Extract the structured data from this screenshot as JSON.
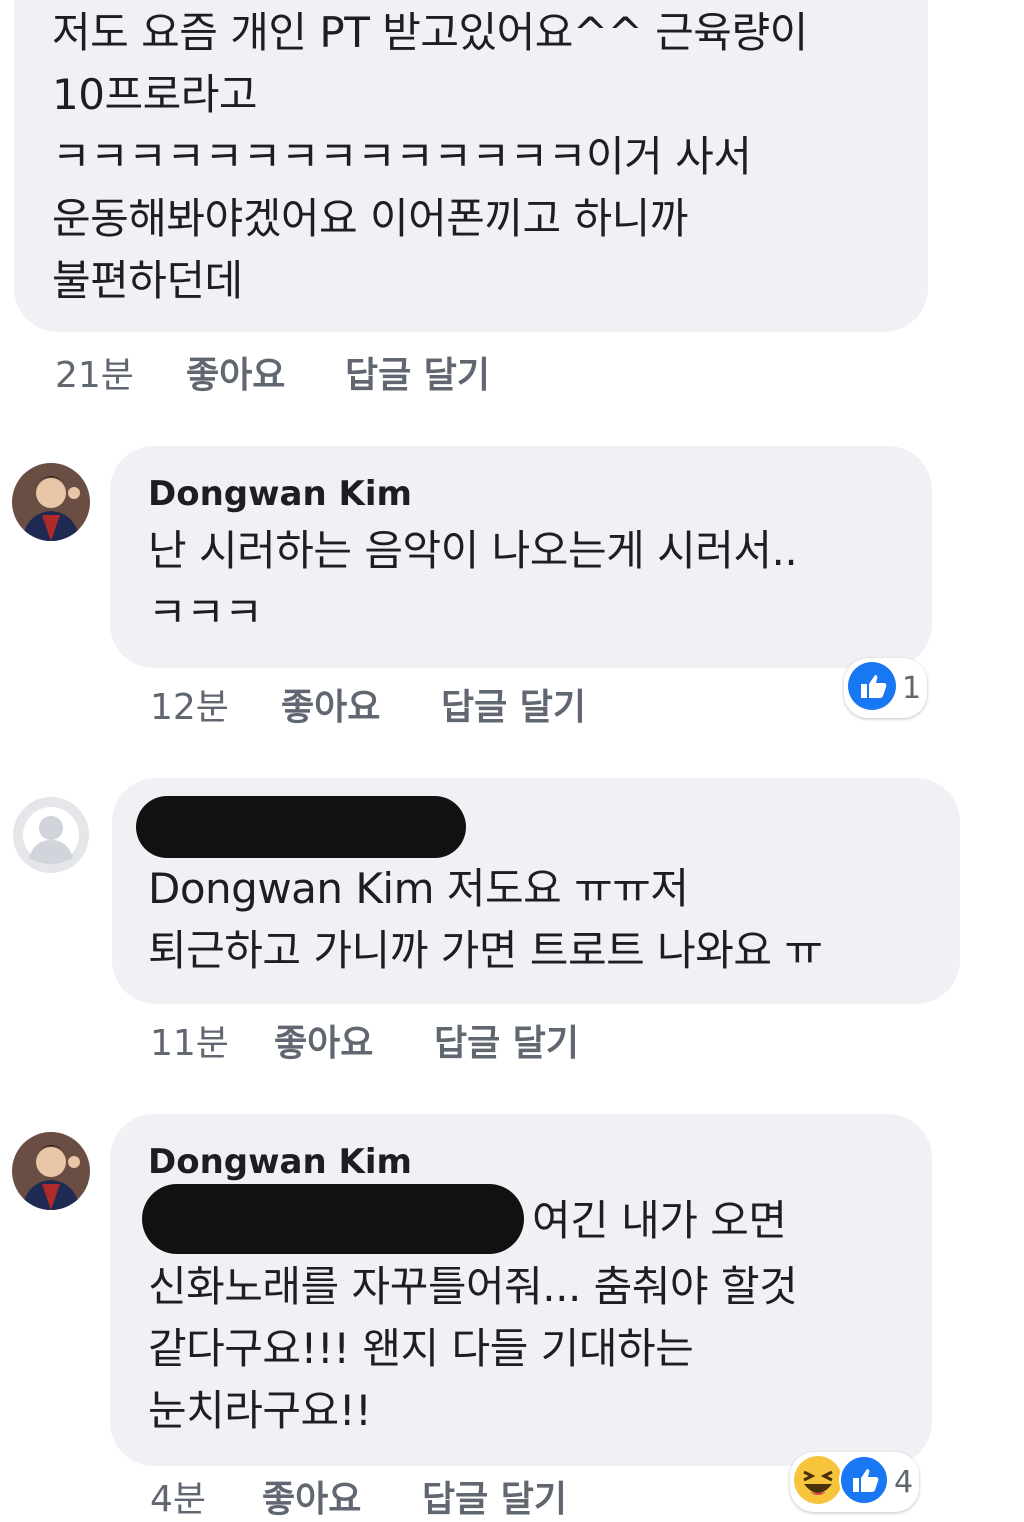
{
  "comments": [
    {
      "author": "",
      "text": "저도 요즘 개인 PT 받고있어요^^ 근육량이\n10프로라고\nㅋㅋㅋㅋㅋㅋㅋㅋㅋㅋㅋㅋㅋㅋ이거 사서\n운동해봐야겠어요 이어폰끼고 하니까\n불편하던데",
      "time": "21분",
      "like": "좋아요",
      "reply": "답글 달기"
    },
    {
      "author": "Dongwan Kim",
      "text": "난 시러하는 음악이 나오는게 시러서..\nㅋㅋㅋ",
      "time": "12분",
      "like": "좋아요",
      "reply": "답글 달기",
      "reaction_count": "1"
    },
    {
      "author": "",
      "text": "Dongwan Kim  저도요 ㅠㅠ저\n퇴근하고 가니까 가면 트로트 나와요 ㅠ",
      "time": "11분",
      "like": "좋아요",
      "reply": "답글 달기"
    },
    {
      "author": "Dongwan Kim",
      "text_first": "여긴 내가 오면",
      "text_rest": "신화노래를 자꾸틀어줘... 춤춰야 할것\n같다구요!!! 왠지 다들 기대하는\n눈치라구요!!",
      "time": "4분",
      "like": "좋아요",
      "reply": "답글 달기",
      "reaction_count": "4"
    }
  ],
  "icons": [
    "like-icon",
    "haha-icon",
    "default-avatar-icon",
    "user-avatar"
  ],
  "colors": {
    "bubble": "#f0f1f4",
    "like_blue": "#1877f2",
    "haha_yellow": "#f7c53c",
    "meta_gray": "#606770"
  }
}
